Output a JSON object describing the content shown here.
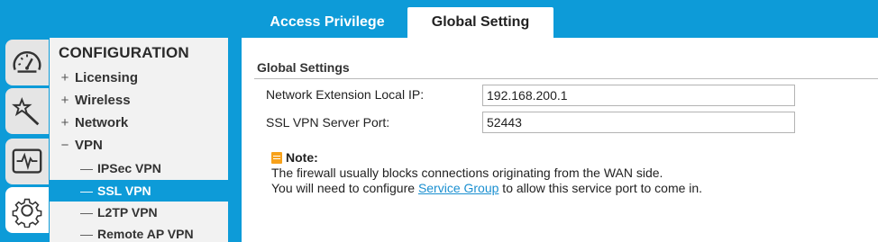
{
  "tabs": [
    {
      "label": "Access Privilege",
      "active": false
    },
    {
      "label": "Global Setting",
      "active": true
    }
  ],
  "sidebar": {
    "icons": [
      {
        "name": "dashboard-gauge-icon",
        "active": false
      },
      {
        "name": "quick-setup-wand-icon",
        "active": false
      },
      {
        "name": "monitor-pulse-icon",
        "active": false
      },
      {
        "name": "configuration-gear-icon",
        "active": true
      }
    ],
    "title": "CONFIGURATION",
    "items": [
      {
        "sign": "+",
        "label": "Licensing"
      },
      {
        "sign": "+",
        "label": "Wireless"
      },
      {
        "sign": "+",
        "label": "Network"
      },
      {
        "sign": "−",
        "label": "VPN"
      }
    ],
    "vpn_children": [
      {
        "dash": "—",
        "label": "IPSec VPN",
        "selected": false
      },
      {
        "dash": "—",
        "label": "SSL VPN",
        "selected": true
      },
      {
        "dash": "—",
        "label": "L2TP VPN",
        "selected": false
      },
      {
        "dash": "—",
        "label": "Remote AP VPN",
        "selected": false
      }
    ]
  },
  "main": {
    "section_title": "Global Settings",
    "fields": [
      {
        "label": "Network Extension Local IP:",
        "value": "192.168.200.1"
      },
      {
        "label": "SSL VPN Server Port:",
        "value": "52443"
      }
    ],
    "note": {
      "heading": "Note:",
      "line1": "The firewall usually blocks connections originating from the WAN side.",
      "line2_pre": "You will need to configure ",
      "line2_link": "Service Group",
      "line2_post": " to allow this service port to come in."
    }
  },
  "colors": {
    "accent": "#0d9bd8",
    "menu_bg": "#f2f2f2",
    "link": "#1a8fd0",
    "note_icon": "#f7a11a"
  }
}
